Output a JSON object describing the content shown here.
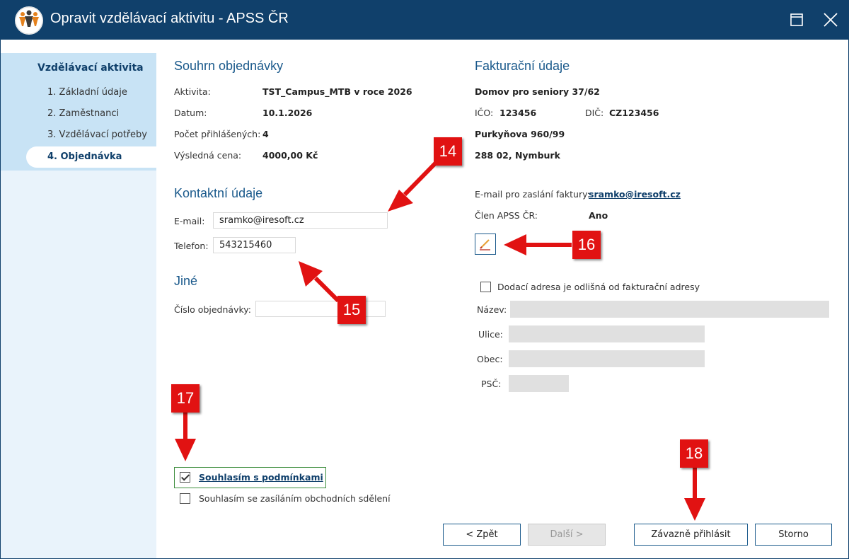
{
  "window": {
    "title": "Opravit vzdělávací aktivitu - APSS ČR",
    "logo_text": "APSS ČR",
    "maximize_icon": "maximize-icon",
    "close_icon": "close-icon"
  },
  "sidebar": {
    "heading": "Vzdělávací aktivita",
    "items": [
      {
        "label": "1. Základní údaje"
      },
      {
        "label": "2. Zaměstnanci"
      },
      {
        "label": "3. Vzdělávací potřeby"
      },
      {
        "label": "4. Objednávka"
      }
    ],
    "active_index": 3
  },
  "summary": {
    "title": "Souhrn objednávky",
    "rows": [
      {
        "label": "Aktivita:",
        "value": "TST_Campus_MTB v roce 2026"
      },
      {
        "label": "Datum:",
        "value": "10.1.2026"
      },
      {
        "label": "Počet přihlášených:",
        "value": "4"
      },
      {
        "label": "Výsledná cena:",
        "value": "4000,00 Kč"
      }
    ]
  },
  "contact": {
    "title": "Kontaktní údaje",
    "email_label": "E-mail:",
    "email_value": "sramko@iresoft.cz",
    "phone_label": "Telefon:",
    "phone_value": "543215460"
  },
  "other": {
    "title": "Jiné",
    "order_number_label": "Číslo objednávky:",
    "order_number_value": ""
  },
  "billing": {
    "title": "Fakturační údaje",
    "name": "Domov pro seniory 37/62",
    "ico_label": "IČO:",
    "ico_value": "123456",
    "dic_label": "DIČ:",
    "dic_value": "CZ123456",
    "street": "Purkyňova 960/99",
    "city": "288 02, Nymburk",
    "invoice_email_label": "E-mail pro zaslání faktury:",
    "invoice_email_value": "sramko@iresoft.cz",
    "member_label": "Člen APSS ČR:",
    "member_value": "Ano",
    "edit_icon": "pencil-icon"
  },
  "delivery": {
    "checkbox_label": "Dodací adresa je odlišná od fakturační adresy",
    "checked": false,
    "fields": [
      {
        "label": "Název:",
        "value": ""
      },
      {
        "label": "Ulice:",
        "value": ""
      },
      {
        "label": "Obec:",
        "value": ""
      },
      {
        "label": "PSČ:",
        "value": ""
      }
    ]
  },
  "consent": {
    "terms_label": "Souhlasím s podmínkami",
    "terms_checked": true,
    "marketing_label": "Souhlasím se zasíláním obchodních sdělení",
    "marketing_checked": false
  },
  "buttons": {
    "back": "< Zpět",
    "next": "Další >",
    "submit": "Závazně přihlásit",
    "cancel": "Storno"
  },
  "annotations": {
    "badges": [
      "14",
      "15",
      "16",
      "17",
      "18"
    ],
    "color": "#e11212"
  },
  "colors": {
    "titlebar": "#10406b",
    "heading": "#1b5a8c",
    "sidebar": "#c8e3f5"
  }
}
